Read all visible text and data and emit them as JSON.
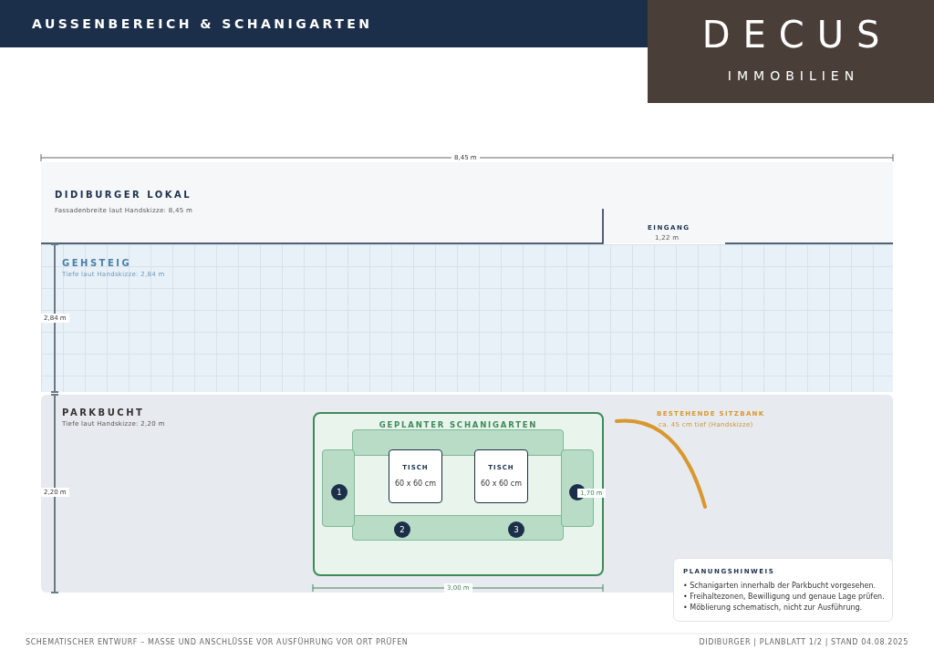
{
  "header": {
    "title": "AUSSENBEREICH & SCHANIGARTEN"
  },
  "logo": {
    "name": "DECUS",
    "subtitle": "IMMOBILIEN"
  },
  "plan": {
    "overall_width": "8,45 m",
    "lokal": {
      "title": "DIDIBURGER LOKAL",
      "note": "Fassadenbreite laut Handskizze: 8,45 m"
    },
    "entrance": {
      "label": "EINGANG",
      "width": "1,22 m"
    },
    "gehsteig": {
      "title": "GEHSTEIG",
      "note": "Tiefe laut Handskizze: 2,84 m",
      "depth": "2,84 m"
    },
    "parkbucht": {
      "title": "PARKBUCHT",
      "note": "Tiefe laut Handskizze: 2,20 m",
      "depth": "2,20 m"
    },
    "schanigarten": {
      "title": "GEPLANTER SCHANIGARTEN",
      "width": "3,00 m",
      "depth": "1,70 m",
      "tables": [
        {
          "label": "TISCH",
          "size": "60 x 60 cm"
        },
        {
          "label": "TISCH",
          "size": "60 x 60 cm"
        }
      ],
      "seats": [
        {
          "number": "1"
        },
        {
          "number": "2"
        },
        {
          "number": "3"
        }
      ]
    },
    "bench": {
      "title": "BESTEHENDE SITZBANK",
      "note": "ca. 45 cm tief (Handskizze)"
    },
    "notes": {
      "title": "PLANUNGSHINWEIS",
      "items": [
        "• Schanigarten innerhalb der Parkbucht vorgesehen.",
        "• Freihaltezonen, Bewilligung und genaue Lage prüfen.",
        "• Möblierung schematisch, nicht zur Ausführung."
      ]
    }
  },
  "footer": {
    "left": "SCHEMATISCHER ENTWURF – MASSE UND ANSCHLÜSSE VOR AUSFÜHRUNG VOR ORT PRÜFEN",
    "right": "DIDIBURGER | PLANBLATT 1/2 | STAND 04.08.2025"
  }
}
